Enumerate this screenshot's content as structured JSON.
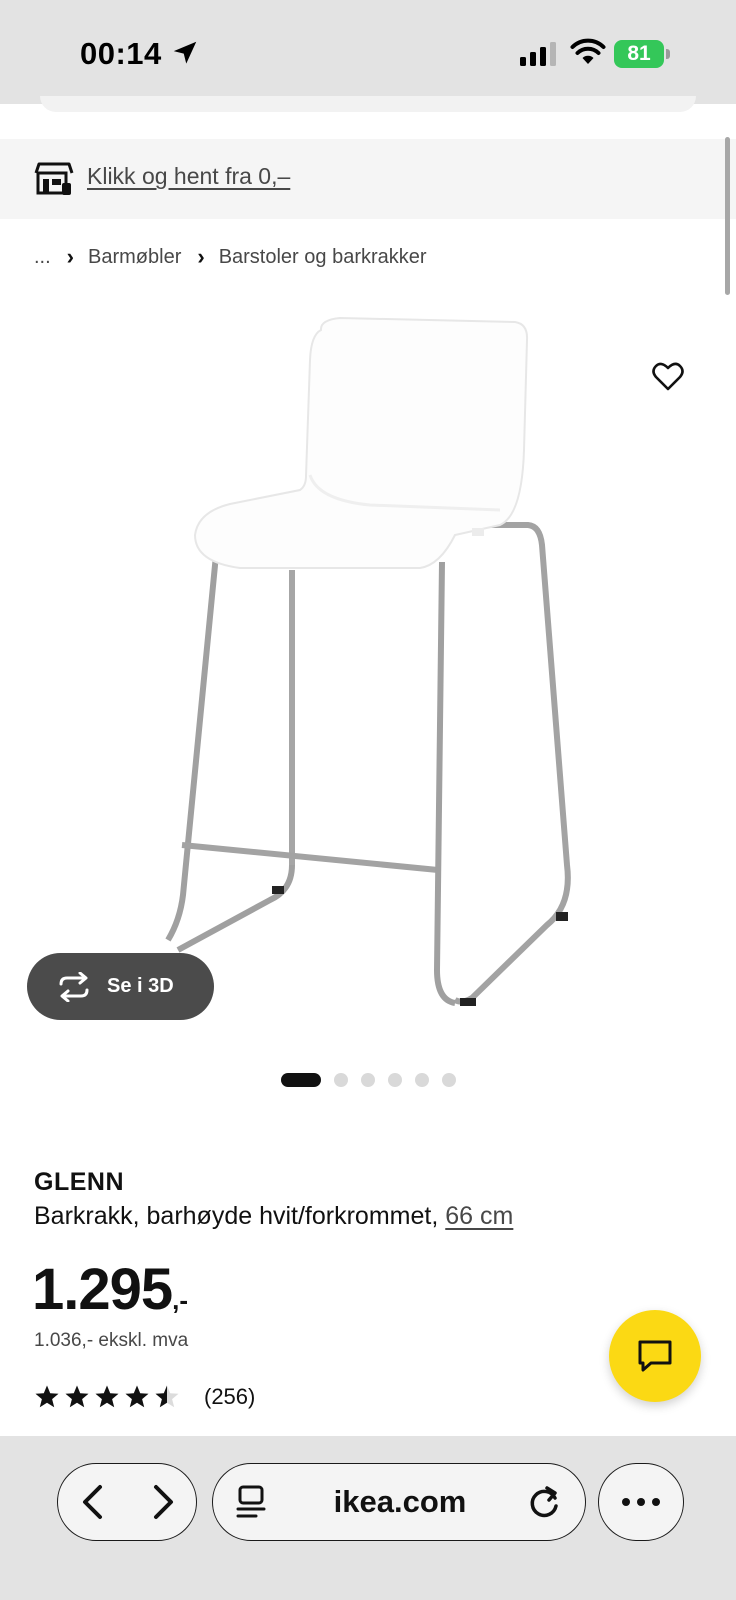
{
  "status_bar": {
    "time": "00:14",
    "battery": "81"
  },
  "promo": {
    "link_text": "Klikk og hent fra 0,–"
  },
  "breadcrumb": {
    "items": [
      "...",
      "Barmøbler",
      "Barstoler og barkrakker"
    ]
  },
  "gallery": {
    "view_3d_label": "Se i 3D",
    "image_count": 6,
    "active_index": 0
  },
  "product": {
    "name": "GLENN",
    "description": "Barkrakk, barhøyde hvit/forkrommet,",
    "size": "66 cm",
    "price_integer": "1.295",
    "price_decimal": ",-",
    "price_excl_vat": "1.036,- ekskl. mva",
    "rating": 4.5,
    "rating_max": 5,
    "review_count": "(256)"
  },
  "browser": {
    "url": "ikea.com"
  },
  "colors": {
    "chat_button": "#fbd914",
    "battery": "#34c759",
    "button_3d": "#4b4b4b"
  }
}
